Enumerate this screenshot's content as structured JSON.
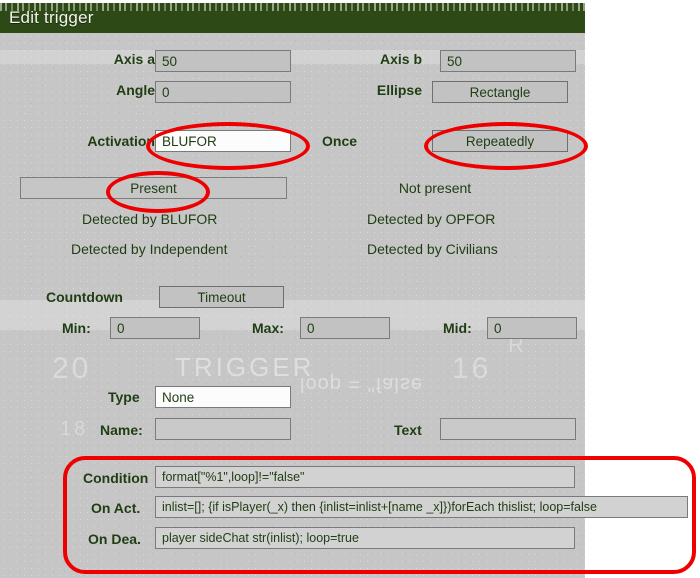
{
  "window": {
    "title": "Edit trigger"
  },
  "geometry": {
    "axis_a_label": "Axis a",
    "axis_a_value": "50",
    "axis_b_label": "Axis b",
    "axis_b_value": "50",
    "angle_label": "Angle",
    "angle_value": "0",
    "shape_label": "Ellipse",
    "shape_value": "Rectangle"
  },
  "activation": {
    "activation_label": "Activation",
    "activation_value": "BLUFOR",
    "once_label": "Once",
    "repeat_value": "Repeatedly"
  },
  "presence": {
    "present": "Present",
    "not_present": "Not present",
    "detected_by_blufor": "Detected by BLUFOR",
    "detected_by_opfor": "Detected by OPFOR",
    "detected_by_independent": "Detected by Independent",
    "detected_by_civilians": "Detected by Civilians"
  },
  "timer": {
    "countdown_label": "Countdown",
    "timeout_value": "Timeout",
    "min_label": "Min:",
    "min_value": "0",
    "max_label": "Max:",
    "max_value": "0",
    "mid_label": "Mid:",
    "mid_value": "0"
  },
  "effects": {
    "type_label": "Type",
    "type_value": "None",
    "name_label": "Name:",
    "name_value": "",
    "text_label": "Text",
    "text_value": ""
  },
  "scripting": {
    "condition_label": "Condition",
    "condition_value": "format[\"%1\",loop]!=\"false\"",
    "on_act_label": "On Act.",
    "on_act_value": "inlist=[]; {if isPlayer(_x) then {inlist=inlist+[name _x]})forEach thislist; loop=false",
    "on_dea_label": "On Dea.",
    "on_dea_value": "player sideChat str(inlist); loop=true"
  },
  "watermarks": {
    "trigger": "TRIGGER",
    "loop_false": "loop = \"false",
    "num_20": "20",
    "num_16": "16",
    "letter_r": "R",
    "num_18": "18"
  },
  "annotation": {
    "color": "#ee0000"
  }
}
